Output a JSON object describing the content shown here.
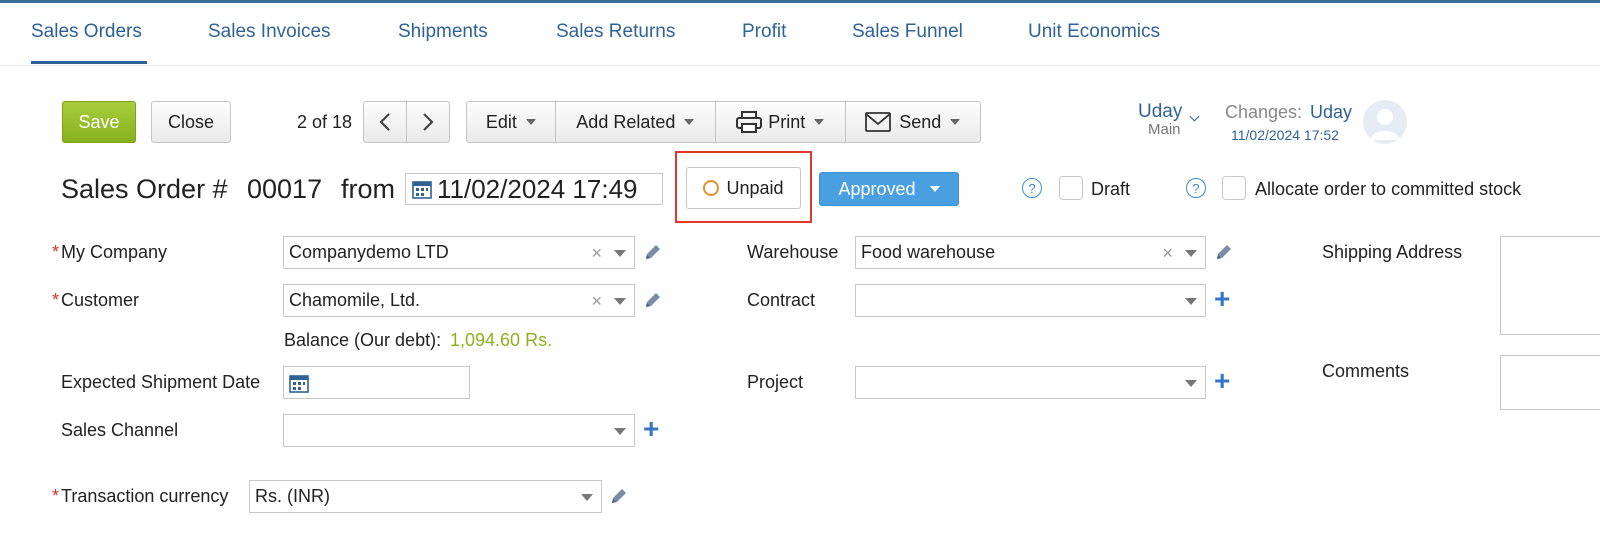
{
  "nav": {
    "tabs": [
      "Sales Orders",
      "Sales Invoices",
      "Shipments",
      "Sales Returns",
      "Profit",
      "Sales Funnel",
      "Unit Economics"
    ]
  },
  "toolbar": {
    "save_label": "Save",
    "close_label": "Close",
    "pager": "2 of 18",
    "edit_label": "Edit",
    "add_related_label": "Add Related",
    "print_label": "Print",
    "send_label": "Send"
  },
  "user": {
    "name": "Uday",
    "branch": "Main",
    "changes_label": "Changes:",
    "changes_user": "Uday",
    "changes_time": "11/02/2024 17:52"
  },
  "order": {
    "title": "Sales Order #",
    "number": "00017",
    "from_label": "from",
    "date": "11/02/2024 17:49",
    "payment_status": "Unpaid",
    "status": "Approved",
    "draft_label": "Draft",
    "allocate_label": "Allocate order to committed stock"
  },
  "form": {
    "my_company_label": "My Company",
    "my_company_value": "Companydemo LTD",
    "customer_label": "Customer",
    "customer_value": "Chamomile, Ltd.",
    "balance_label": "Balance (Our debt):",
    "balance_value": "1,094.60 Rs.",
    "expected_shipment_label": "Expected Shipment Date",
    "sales_channel_label": "Sales Channel",
    "currency_label": "Transaction currency",
    "currency_value": "Rs. (INR)",
    "warehouse_label": "Warehouse",
    "warehouse_value": "Food warehouse",
    "contract_label": "Contract",
    "project_label": "Project",
    "shipping_address_label": "Shipping Address",
    "comments_label": "Comments"
  },
  "colors": {
    "accent": "#2f6398",
    "save_green": "#8fb826",
    "approved_blue": "#4a9fe0",
    "highlight_red": "#e0382c",
    "balance_green": "#8ab21b",
    "unpaid_orange": "#e8902c"
  }
}
